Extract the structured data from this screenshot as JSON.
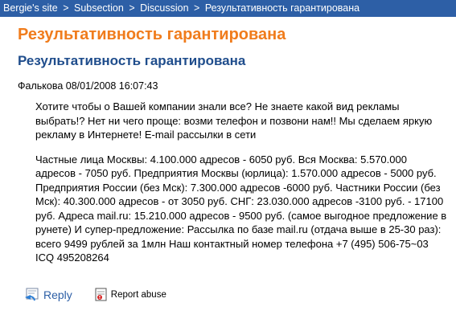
{
  "breadcrumb": {
    "items": [
      {
        "label": "Bergie's site"
      },
      {
        "label": "Subsection"
      },
      {
        "label": "Discussion"
      }
    ],
    "separator": ">",
    "current": "Результативность гарантирована"
  },
  "site_title": "Результативность гарантирована",
  "post": {
    "title": "Результативность гарантирована",
    "author": "Фалькова",
    "datetime": "08/01/2008 16:07:43",
    "paragraphs": [
      "Хотите чтобы о Вашей компании знали все? Не знаете какой вид рекламы выбрать!? Нет ни чего проще: возми телефон и позвони нам!! Мы сделаем яркую рекламу в Интернете! E-mail рассылки в сети",
      "Частные лица Москвы: 4.100.000 адресов - 6050 руб. Вся Москва: 5.570.000 адресов - 7050 руб. Предприятия Москвы (юрлица): 1.570.000 адресов - 5000 руб. Предприятия России (без Мск): 7.300.000 адресов -6000 руб. Частники России (без Мск): 40.300.000 адресов - от 3050 руб. СНГ: 23.030.000 адресов -3100 руб. - 17100 руб. Адреса mail.ru: 15.210.000 адресов - 9500 руб. (самое выгодное предложение в рунете) И супер-предложение: Рассылка по базе mail.ru (отдача выше в 25-30 раз): всего 9499 рублей за 1млн Наш контактный номер телефона +7 (495) 506-75~03 ICQ 495208264"
    ]
  },
  "actions": {
    "reply_label": "Reply",
    "reply_icon": "reply-icon",
    "report_label": "Report abuse",
    "report_icon": "report-abuse-icon"
  },
  "colors": {
    "breadcrumb_bg": "#2d5fa6",
    "site_title": "#f07c1c",
    "post_title": "#1f4d8c",
    "link": "#2d5fa6"
  }
}
